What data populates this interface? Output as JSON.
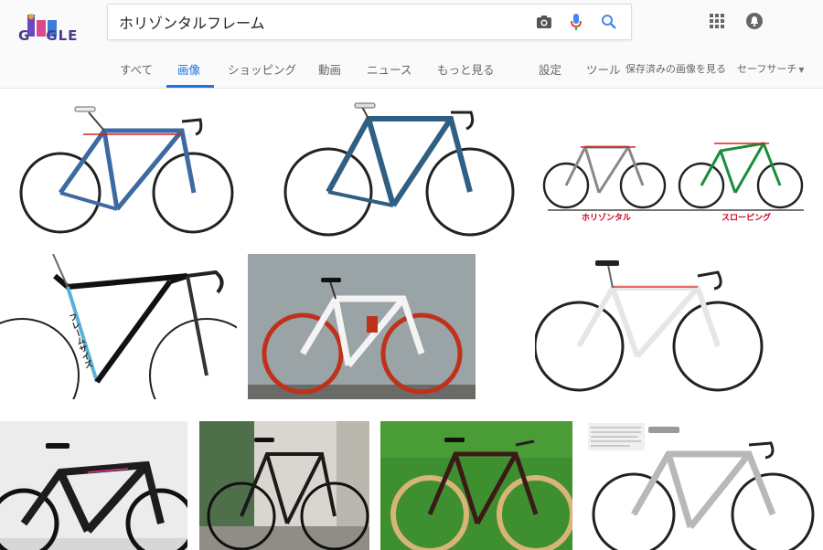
{
  "logo": {
    "text": "G  GLE"
  },
  "search": {
    "value": "ホリゾンタルフレーム"
  },
  "tabs": [
    {
      "label": "すべて"
    },
    {
      "label": "画像"
    },
    {
      "label": "ショッピング"
    },
    {
      "label": "動画"
    },
    {
      "label": "ニュース"
    },
    {
      "label": "もっと見る"
    }
  ],
  "tools": {
    "settings": "設定",
    "tools": "ツール",
    "saved": "保存済みの画像を見る",
    "safesearch": "セーフサーチ"
  },
  "results": {
    "r3": {
      "label_left": "ホリゾンタル",
      "label_right": "スローピング"
    },
    "r4": {
      "frame_label": "フレームサイズ"
    }
  },
  "colors": {
    "accent": "#1a73e8",
    "frame_blue": "#2f5f82",
    "frame_black": "#1d1d1d",
    "frame_white": "#f4f4f4",
    "frame_silver": "#b8b8b8",
    "highlight_red": "#e21b1b",
    "tab_text": "#666666"
  }
}
